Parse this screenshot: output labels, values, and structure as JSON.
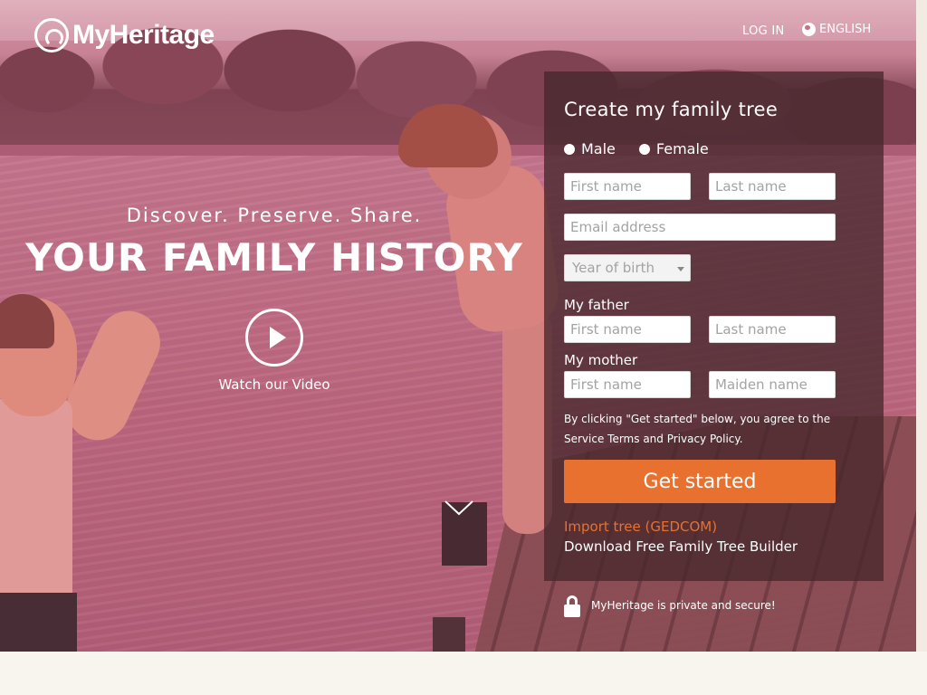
{
  "header": {
    "logo_text": "MyHeritage",
    "login_label": "LOG IN",
    "language_label": "ENGLISH"
  },
  "hero": {
    "tagline": "Discover. Preserve. Share.",
    "headline": "YOUR FAMILY HISTORY",
    "video_label": "Watch our Video"
  },
  "form": {
    "title": "Create my family tree",
    "gender_male": "Male",
    "gender_female": "Female",
    "first_name_placeholder": "First name",
    "last_name_placeholder": "Last name",
    "email_placeholder": "Email address",
    "year_of_birth_placeholder": "Year of birth",
    "father_label": "My father",
    "father_first_placeholder": "First name",
    "father_last_placeholder": "Last name",
    "mother_label": "My mother",
    "mother_first_placeholder": "First name",
    "mother_maiden_placeholder": "Maiden name",
    "terms_text": "By clicking \"Get started\" below, you agree to the Service Terms and Privacy Policy.",
    "submit_label": "Get started",
    "import_link": "Import tree (GEDCOM)",
    "download_link": "Download Free Family Tree Builder"
  },
  "security": {
    "text": "MyHeritage is private and secure!"
  },
  "colors": {
    "accent": "#e8712f",
    "panel": "#46282d"
  }
}
